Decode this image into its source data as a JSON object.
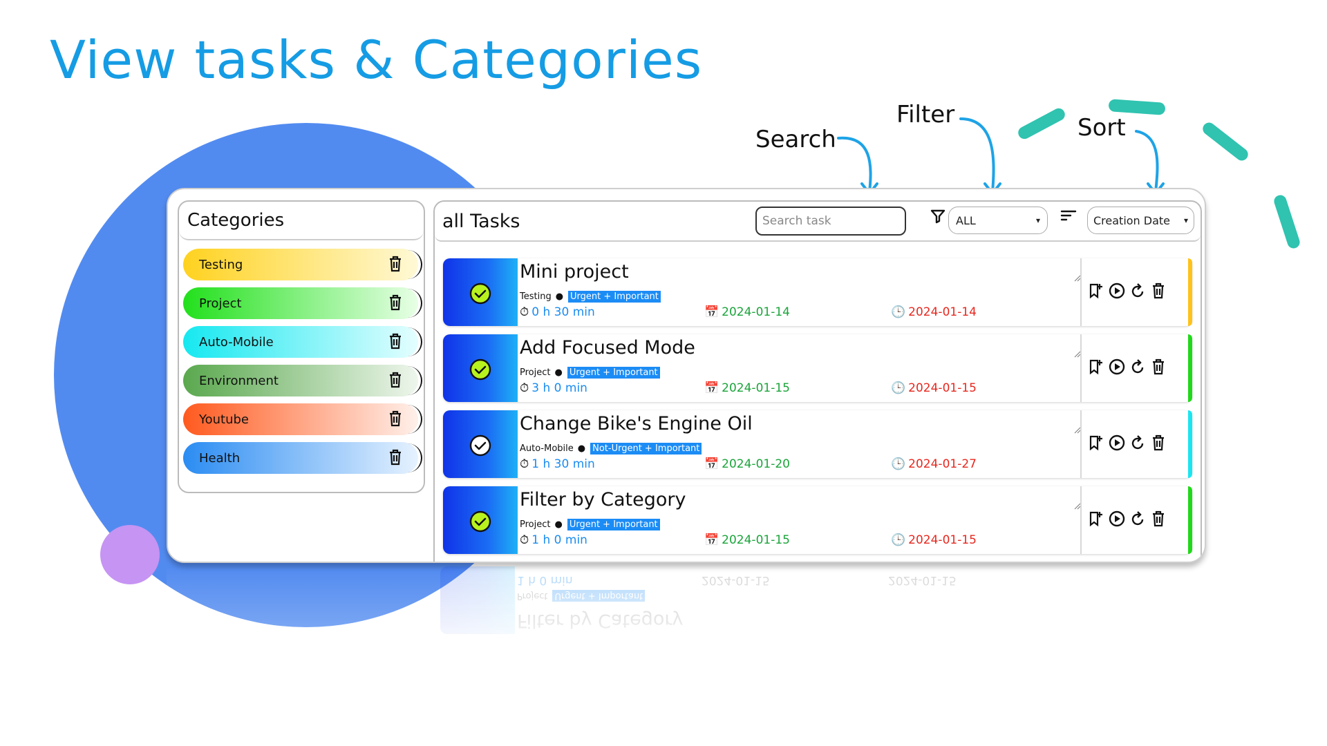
{
  "slide": {
    "title": "View tasks & Categories",
    "annotations": {
      "search": "Search",
      "filter": "Filter",
      "sort": "Sort"
    },
    "colors": {
      "title": "#159ce4",
      "circle": "#528bf0",
      "dot": "#c694f3",
      "dash": "#2fc3b0",
      "arrow": "#1ea3e6"
    }
  },
  "categories": {
    "heading": "Categories",
    "items": [
      {
        "label": "Testing",
        "color": "#ffd21f"
      },
      {
        "label": "Project",
        "color": "#22e01c"
      },
      {
        "label": "Auto-Mobile",
        "color": "#16e8f0"
      },
      {
        "label": "Environment",
        "color": "#5aa84e"
      },
      {
        "label": "Youtube",
        "color": "#ff5a1f"
      },
      {
        "label": "Health",
        "color": "#2b8cf2"
      }
    ]
  },
  "tasks_panel": {
    "heading": "all Tasks",
    "search_placeholder": "Search task",
    "filter_value": "ALL",
    "sort_value": "Creation Date"
  },
  "tasks": [
    {
      "title": "Mini project",
      "category": "Testing",
      "priority": "Urgent + Important",
      "duration": "0 h 30 min",
      "created": "2024-01-14",
      "due": "2024-01-14",
      "accent": "#ffc21a",
      "done": true
    },
    {
      "title": "Add Focused Mode",
      "category": "Project",
      "priority": "Urgent + Important",
      "duration": "3 h 0 min",
      "created": "2024-01-15",
      "due": "2024-01-15",
      "accent": "#22d81a",
      "done": true
    },
    {
      "title": "Change Bike's Engine Oil",
      "category": "Auto-Mobile",
      "priority": "Not-Urgent + Important",
      "duration": "1 h 30 min",
      "created": "2024-01-20",
      "due": "2024-01-27",
      "accent": "#19e6f0",
      "done": false
    },
    {
      "title": "Filter by Category",
      "category": "Project",
      "priority": "Urgent + Important",
      "duration": "1 h 0 min",
      "created": "2024-01-15",
      "due": "2024-01-15",
      "accent": "#22d81a",
      "done": true
    }
  ],
  "icons": [
    "trash-icon",
    "filter-icon",
    "sort-icon",
    "check-circle-icon",
    "timer-icon",
    "calendar-icon",
    "clock-icon",
    "bookmark-add-icon",
    "play-icon",
    "restart-icon"
  ]
}
